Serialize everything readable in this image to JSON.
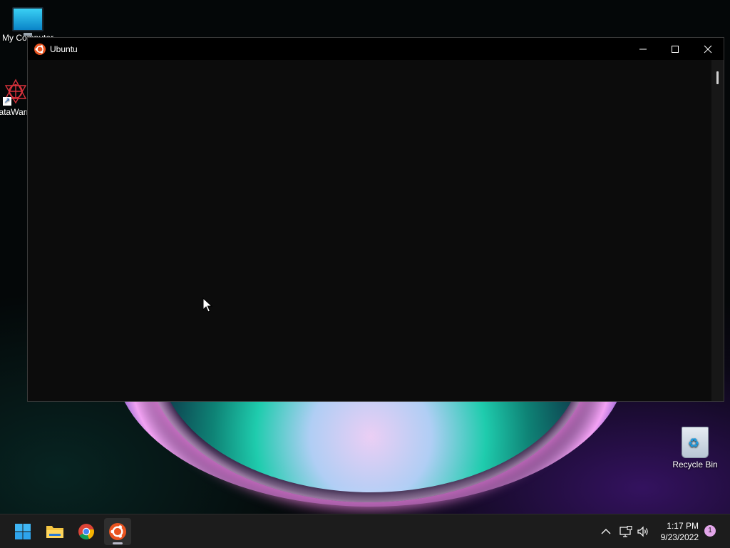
{
  "desktop": {
    "icons": [
      {
        "label": "My Computer",
        "icon": "monitor-icon"
      },
      {
        "label": "DataWarrior",
        "icon": "datawarrior-icon"
      },
      {
        "label": "Recycle Bin",
        "icon": "recycle-bin-icon"
      }
    ]
  },
  "window": {
    "title": "Ubuntu",
    "icon": "ubuntu-icon",
    "controls": [
      "minimize-icon",
      "maximize-icon",
      "close-icon"
    ],
    "terminal_text": ""
  },
  "taskbar": {
    "apps": [
      {
        "name": "Start",
        "icon": "windows-start-icon"
      },
      {
        "name": "File Explorer",
        "icon": "folder-icon"
      },
      {
        "name": "Google Chrome",
        "icon": "chrome-icon"
      },
      {
        "name": "Ubuntu",
        "icon": "ubuntu-icon",
        "active": true
      }
    ],
    "tray": {
      "icons": [
        "chevron-up-icon",
        "network-icon",
        "volume-icon"
      ],
      "time": "1:17 PM",
      "date": "9/23/2022",
      "notification_count": "1"
    }
  },
  "colors": {
    "ubuntu_orange": "#e95420",
    "taskbar_bg": "#1c1c1c",
    "terminal_bg": "#0c0c0c"
  }
}
